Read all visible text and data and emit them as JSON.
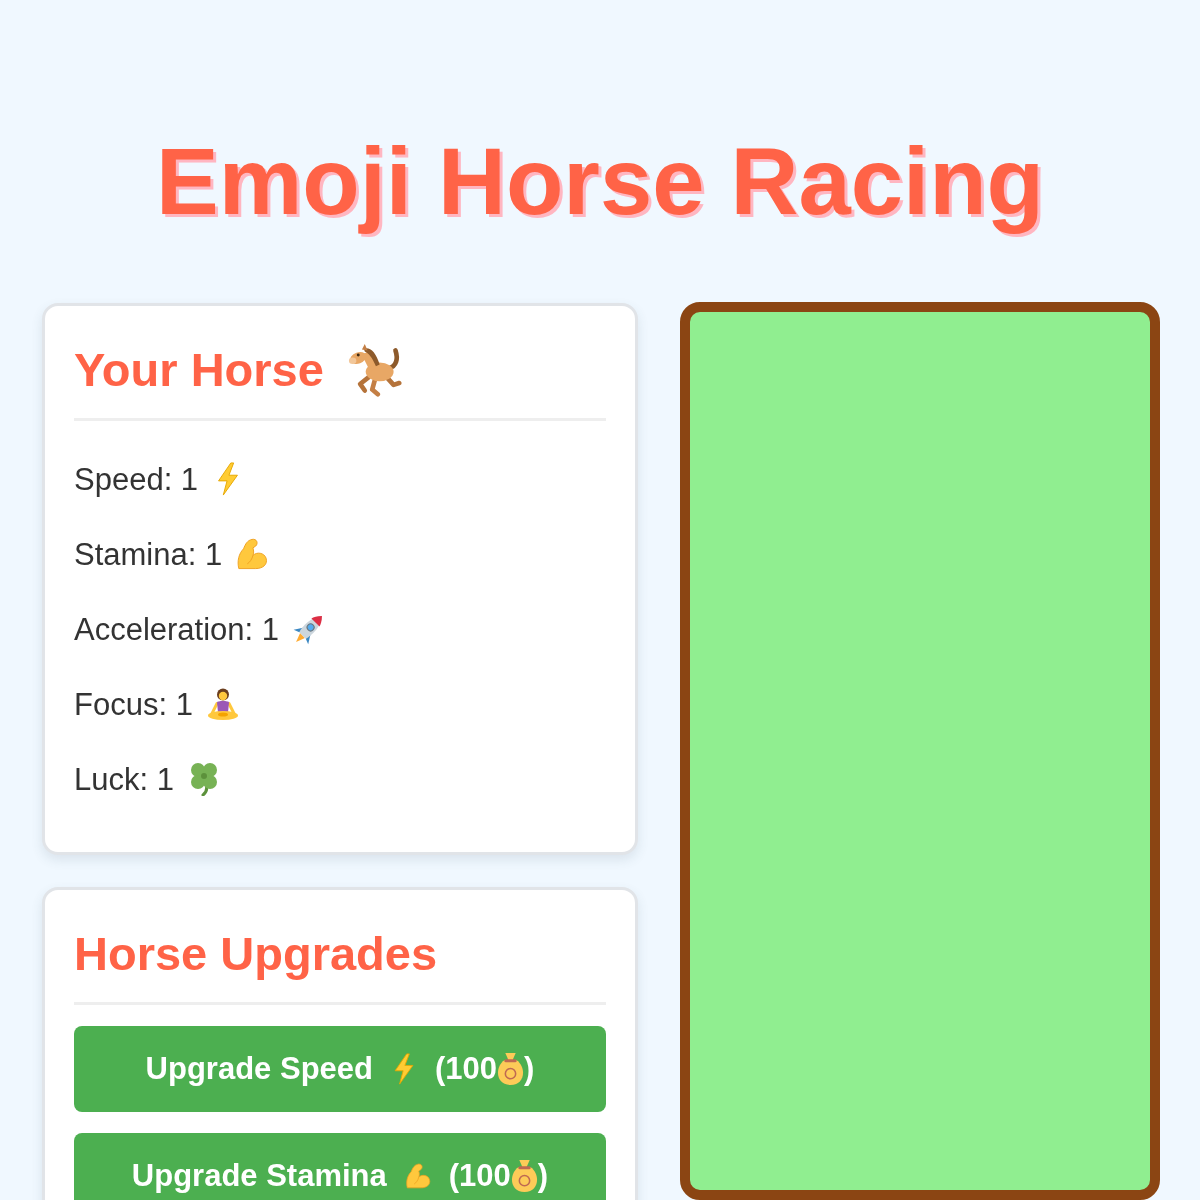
{
  "title": "Emoji Horse Racing",
  "horse_card": {
    "heading": "Your Horse",
    "stats": [
      {
        "kind": "speed",
        "text": "Speed: 1"
      },
      {
        "kind": "stamina",
        "text": "Stamina: 1"
      },
      {
        "kind": "acceleration",
        "text": "Acceleration: 1"
      },
      {
        "kind": "focus",
        "text": "Focus: 1"
      },
      {
        "kind": "luck",
        "text": "Luck: 1"
      }
    ]
  },
  "upgrades_card": {
    "heading": "Horse Upgrades",
    "buttons": [
      {
        "kind": "speed",
        "label": "Upgrade Speed",
        "cost": "(100",
        "cost_end": ")"
      },
      {
        "kind": "stamina",
        "label": "Upgrade Stamina",
        "cost": "(100",
        "cost_end": ")"
      }
    ]
  }
}
